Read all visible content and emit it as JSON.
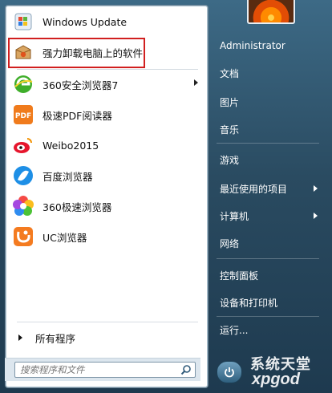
{
  "programs": [
    {
      "label": "Windows Update",
      "icon": "windows-update-icon"
    },
    {
      "label": "强力卸载电脑上的软件",
      "icon": "uninstaller-box-icon"
    },
    {
      "label": "360安全浏览器7",
      "icon": "360-browser-icon",
      "has_submenu": true
    },
    {
      "label": "极速PDF阅读器",
      "icon": "pdf-reader-icon"
    },
    {
      "label": "Weibo2015",
      "icon": "weibo-icon"
    },
    {
      "label": "百度浏览器",
      "icon": "baidu-browser-icon"
    },
    {
      "label": "360极速浏览器",
      "icon": "360-speed-browser-icon"
    },
    {
      "label": "UC浏览器",
      "icon": "uc-browser-icon"
    }
  ],
  "all_programs": "所有程序",
  "search": {
    "placeholder": "搜索程序和文件"
  },
  "right_menu": [
    {
      "label": "Administrator"
    },
    {
      "label": "文档"
    },
    {
      "label": "图片"
    },
    {
      "label": "音乐"
    },
    {
      "label": "游戏"
    },
    {
      "label": "最近使用的项目",
      "has_submenu": true
    },
    {
      "label": "计算机",
      "has_submenu": true
    },
    {
      "label": "网络"
    },
    {
      "label": "控制面板"
    },
    {
      "label": "设备和打印机"
    },
    {
      "label": "运行..."
    }
  ],
  "watermark": {
    "cn": "系统天堂",
    "en": "xpgod"
  },
  "colors": {
    "highlight": "#d11f1f",
    "pane_bg": "#ffffff",
    "right_text": "#ffffff"
  }
}
